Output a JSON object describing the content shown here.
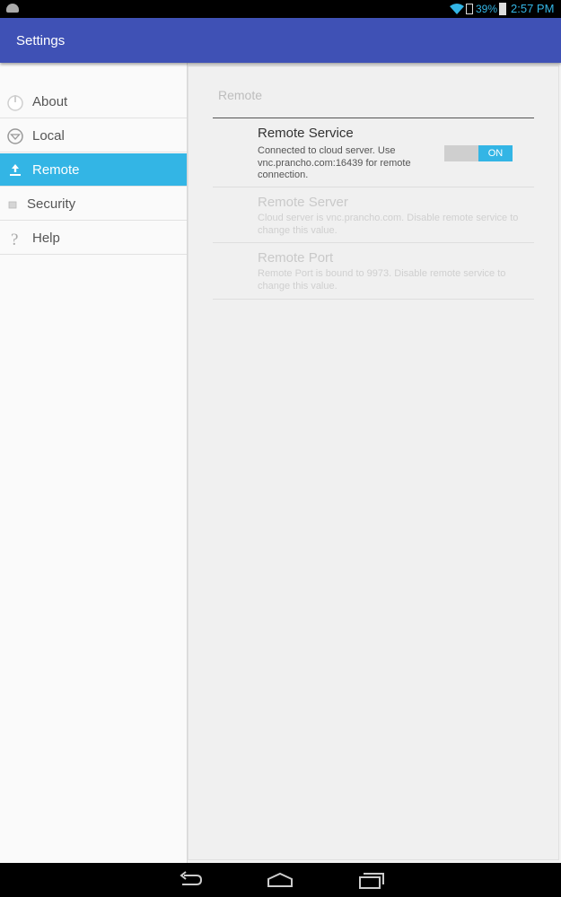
{
  "status_bar": {
    "battery_percent": "39%",
    "time": "2:57 PM"
  },
  "app_bar": {
    "title": "Settings"
  },
  "sidebar": {
    "items": [
      {
        "label": "About",
        "icon": "about-icon",
        "active": false
      },
      {
        "label": "Local",
        "icon": "local-icon",
        "active": false
      },
      {
        "label": "Remote",
        "icon": "upload-icon",
        "active": true
      },
      {
        "label": "Security",
        "icon": "lock-icon",
        "active": false
      },
      {
        "label": "Help",
        "icon": "question-icon",
        "active": false
      }
    ]
  },
  "panel": {
    "section_title": "Remote",
    "prefs": {
      "remote_service": {
        "title": "Remote Service",
        "summary": "Connected to cloud server. Use vnc.prancho.com:16439 for remote connection.",
        "toggle_label": "ON",
        "enabled": true
      },
      "remote_server": {
        "title": "Remote Server",
        "summary": "Cloud server is vnc.prancho.com. Disable remote service to change this value.",
        "enabled": false
      },
      "remote_port": {
        "title": "Remote Port",
        "summary": "Remote Port is bound to 9973. Disable remote service to change this value.",
        "enabled": false
      }
    }
  },
  "colors": {
    "app_bar": "#3f51b5",
    "accent": "#33b5e5"
  }
}
